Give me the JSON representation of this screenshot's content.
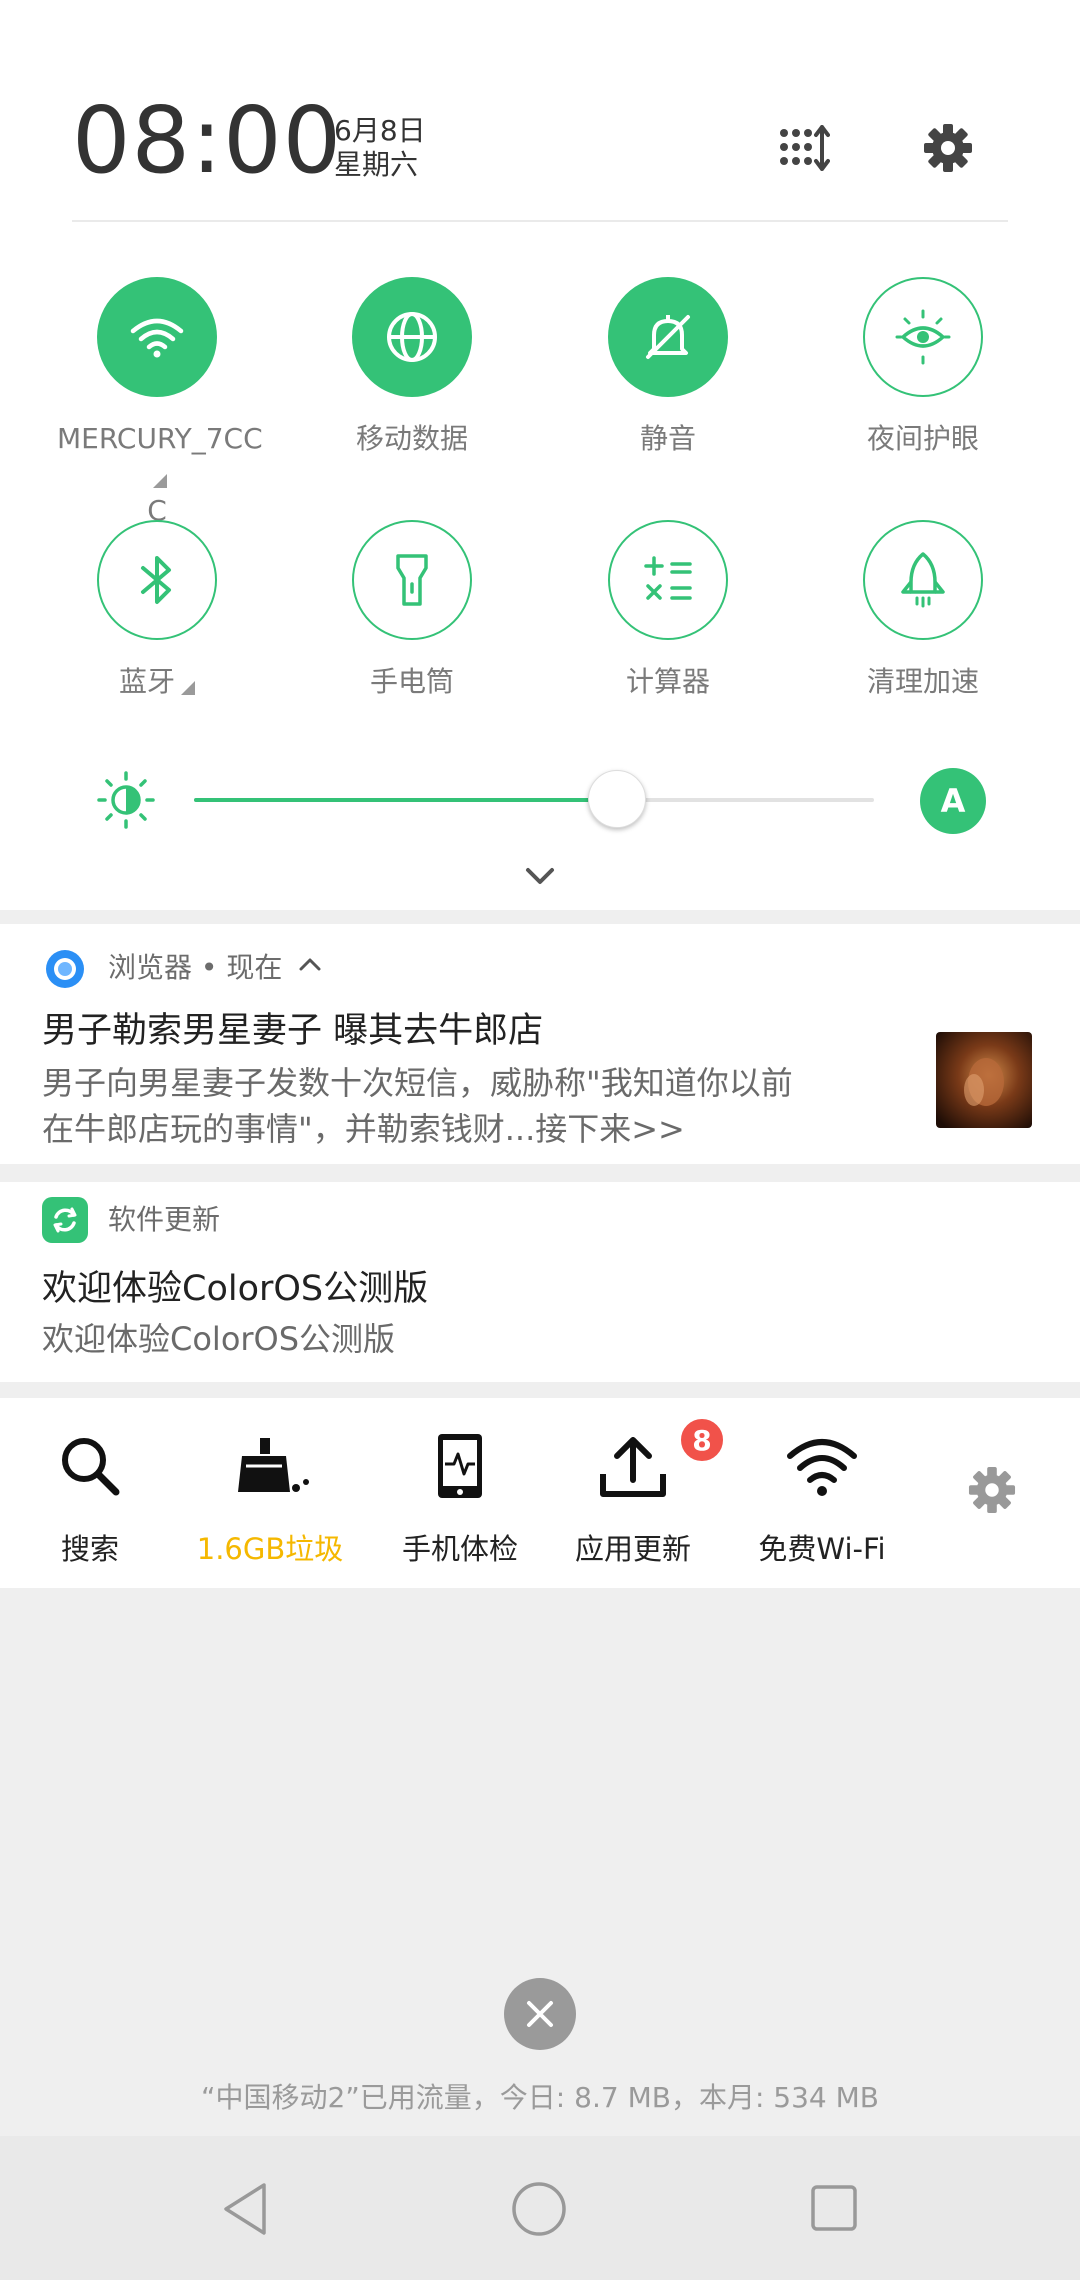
{
  "header": {
    "time": "08:00",
    "date": "6月8日",
    "weekday": "星期六",
    "edit_icon": "grid-sort-icon",
    "settings_icon": "gear-icon"
  },
  "quick_tiles": [
    {
      "label_line1": "MERCURY_7CC",
      "label_line2": "C",
      "icon": "wifi-icon",
      "active": true
    },
    {
      "label": "移动数据",
      "icon": "globe-icon",
      "active": true
    },
    {
      "label": "静音",
      "icon": "bell-off-icon",
      "active": true
    },
    {
      "label": "夜间护眼",
      "icon": "eye-icon",
      "active": false
    },
    {
      "label": "蓝牙",
      "icon": "bluetooth-icon",
      "active": false
    },
    {
      "label": "手电筒",
      "icon": "flashlight-icon",
      "active": false
    },
    {
      "label": "计算器",
      "icon": "calculator-icon",
      "active": false
    },
    {
      "label": "清理加速",
      "icon": "rocket-icon",
      "active": false
    }
  ],
  "brightness": {
    "level": 0.62,
    "auto_label": "A"
  },
  "notifications": [
    {
      "app": "浏览器 • 现在",
      "title": "男子勒索男星妻子 曝其去牛郎店",
      "body_line1": "男子向男星妻子发数十次短信，威胁称\"我知道你以前",
      "body_line2": "在牛郎店玩的事情\"，并勒索钱财...接下来>>"
    },
    {
      "app": "软件更新",
      "title": "欢迎体验ColorOS公测版",
      "body": "欢迎体验ColorOS公测版"
    }
  ],
  "tools": [
    {
      "label": "搜索",
      "icon": "search-icon"
    },
    {
      "label": "1.6GB垃圾",
      "icon": "broom-icon"
    },
    {
      "label": "手机体检",
      "icon": "phone-check-icon"
    },
    {
      "label": "应用更新",
      "icon": "upload-icon",
      "badge": "8"
    },
    {
      "label": "免费Wi-Fi",
      "icon": "wifi-icon"
    }
  ],
  "colors": {
    "accent": "#34c277",
    "junk_text": "#f5b800",
    "badge": "#f1524a"
  },
  "data_usage": "“中国移动2”已用流量，今日: 8.7 MB，本月: 534 MB"
}
